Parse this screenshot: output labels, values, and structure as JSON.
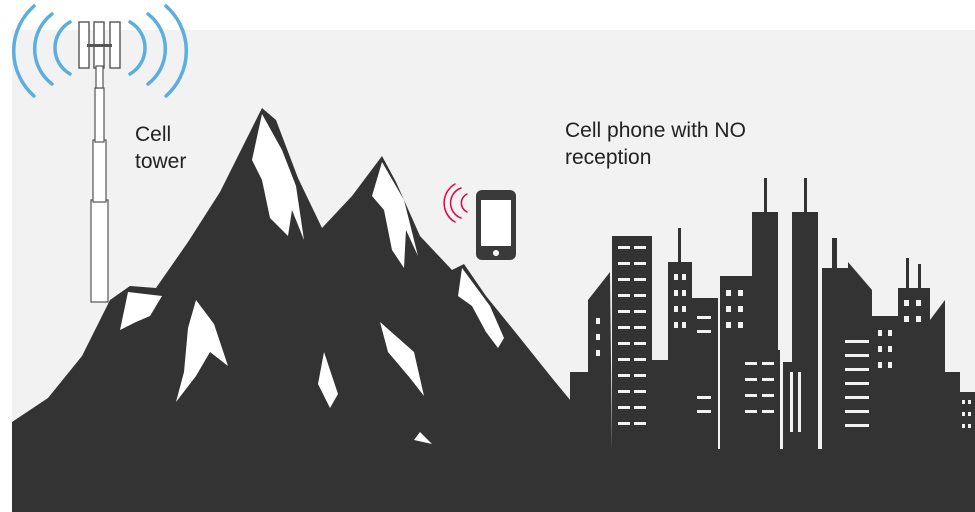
{
  "labels": {
    "cell_tower": [
      "Cell",
      "tower"
    ],
    "cell_phone": [
      "Cell phone with NO",
      "reception"
    ]
  },
  "colors": {
    "background_panel": "#f2f2f2",
    "silhouette": "#333333",
    "snow": "#ffffff",
    "tower_signal": "#5aaee0",
    "phone_signal": "#e0004d",
    "phone_body": "#3a3a3a"
  },
  "icons": {
    "tower": "cell-tower-icon",
    "phone": "mobile-phone-icon",
    "tower_waves": "signal-waves-icon",
    "phone_waves": "weak-signal-icon"
  }
}
